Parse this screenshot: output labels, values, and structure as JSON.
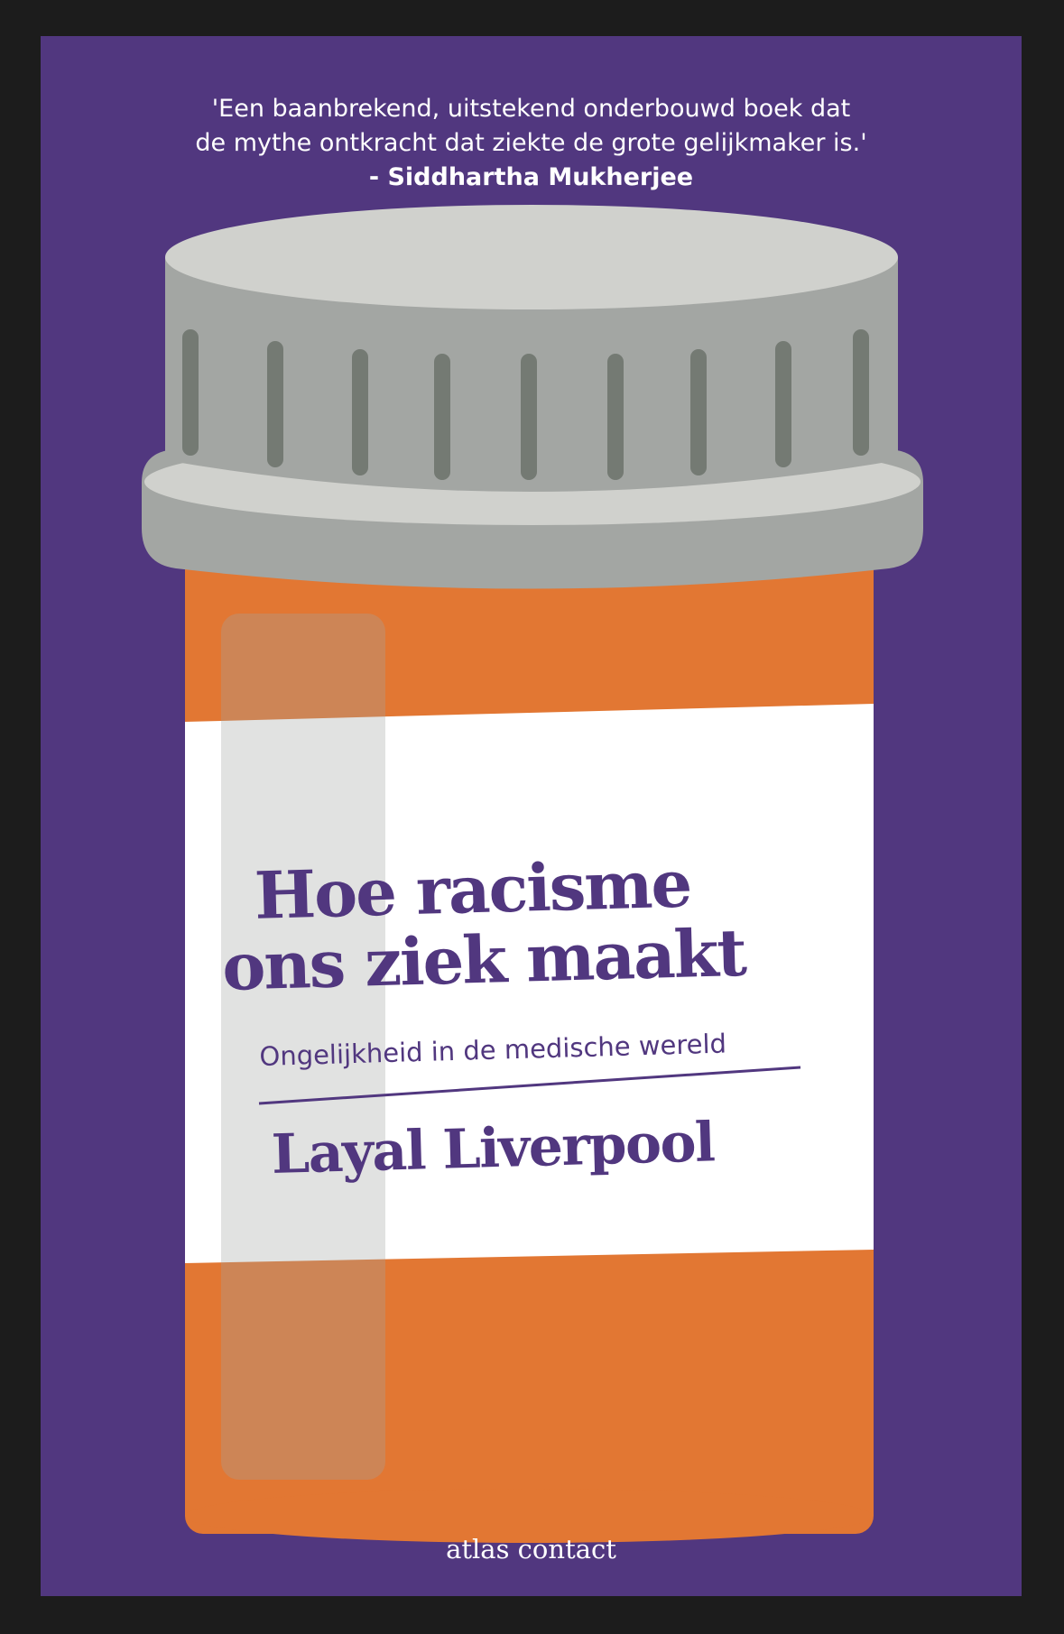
{
  "cover": {
    "background_color": "#51377f",
    "quote": {
      "line1": "'Een baanbrekend, uitstekend onderbouwd boek dat",
      "line2": "de mythe ontkracht dat ziekte de grote gelijkmaker is.'",
      "attribution": "- Siddhartha Mukherjee"
    },
    "title": {
      "line1": "Hoe racisme",
      "line2": "ons ziek maakt"
    },
    "subtitle": "Ongelijkheid in de medische wereld",
    "author": "Layal Liverpool",
    "publisher": "atlas contact",
    "illustration": {
      "name": "pill-bottle",
      "cap_color": "#a3a6a3",
      "bottle_color": "#e27733",
      "label_color": "#ffffff",
      "text_color": "#51377f"
    }
  }
}
